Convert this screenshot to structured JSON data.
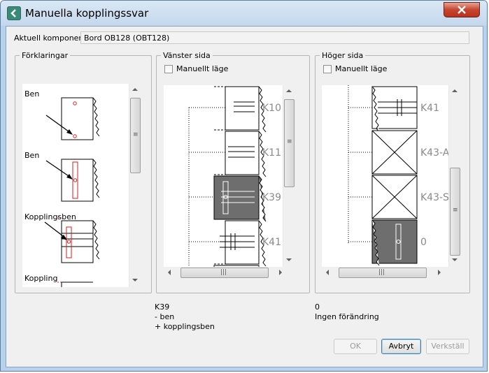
{
  "window": {
    "title": "Manuella kopplingssvar",
    "icon": "back-arrow-icon",
    "close": "close-icon"
  },
  "component": {
    "label": "Aktuell komponent",
    "value": "Bord OB128 (OBT128)"
  },
  "legend_panel": {
    "title": "Förklaringar",
    "items": [
      {
        "label": "Ben"
      },
      {
        "label": "Ben"
      },
      {
        "label": "Kopplingsben"
      },
      {
        "label": "Koppling"
      }
    ]
  },
  "left_panel": {
    "title": "Vänster sida",
    "manual_label": "Manuellt läge",
    "blocks": [
      "K10",
      "K11",
      "K39",
      "K41"
    ]
  },
  "right_panel": {
    "title": "Höger sida",
    "manual_label": "Manuellt läge",
    "blocks": [
      "K41",
      "K43-A",
      "K43-S",
      "0"
    ]
  },
  "left_status": {
    "line1": "K39",
    "line2": "- ben",
    "line3": "+ kopplingsben"
  },
  "right_status": {
    "line1": "0",
    "line2": "Ingen förändring"
  },
  "buttons": {
    "ok": "OK",
    "cancel": "Avbryt",
    "apply": "Verkställ"
  },
  "colors": {
    "selected_block": "#6e6e6e",
    "accent_red": "#d02020",
    "frame": "#b9d1ea"
  }
}
